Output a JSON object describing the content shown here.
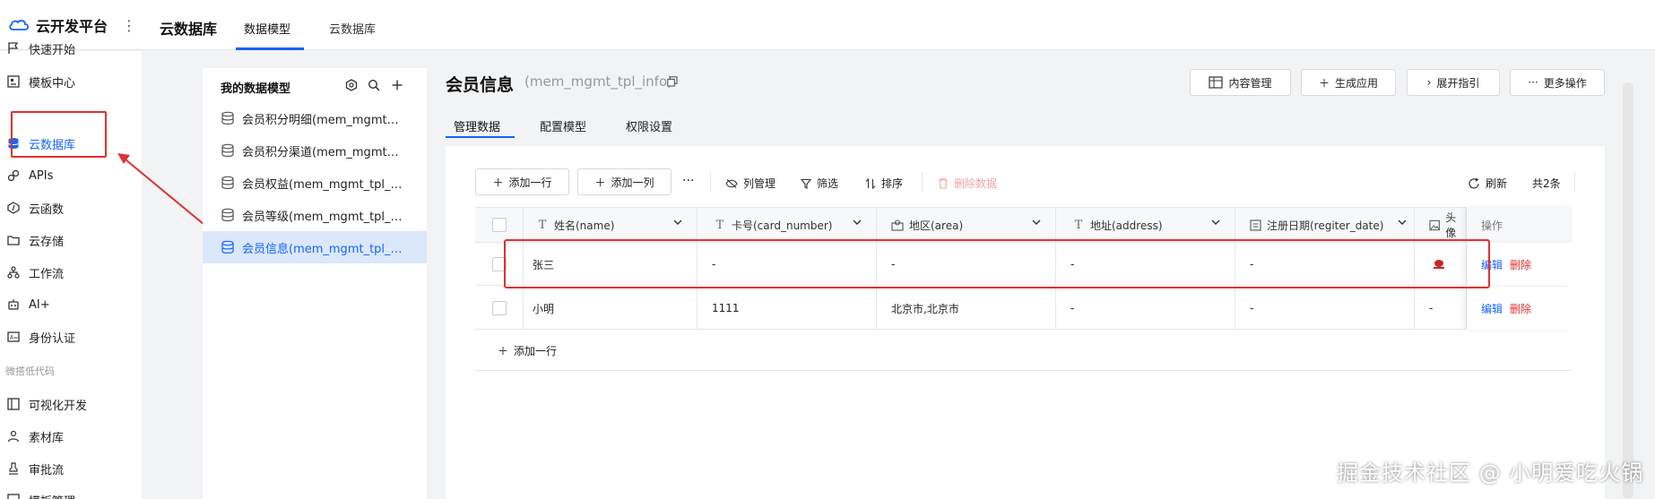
{
  "brand": {
    "title": "云开发平台",
    "more": "⋮"
  },
  "header": {
    "title": "云数据库",
    "tabs": [
      {
        "label": "数据模型",
        "active": true
      },
      {
        "label": "云数据库",
        "active": false
      }
    ]
  },
  "sidebar": {
    "items": [
      {
        "label": "快速开始",
        "icon": "flag-icon"
      },
      {
        "label": "模板中心",
        "icon": "template-icon"
      },
      {
        "label": "云数据库",
        "icon": "database-icon",
        "active": true
      },
      {
        "label": "APIs",
        "icon": "link-icon"
      },
      {
        "label": "云函数",
        "icon": "function-icon"
      },
      {
        "label": "云存储",
        "icon": "folder-icon"
      },
      {
        "label": "工作流",
        "icon": "workflow-icon"
      },
      {
        "label": "AI+",
        "icon": "robot-icon"
      },
      {
        "label": "身份认证",
        "icon": "id-card-icon"
      },
      {
        "label": "可视化开发",
        "icon": "layout-icon"
      },
      {
        "label": "素材库",
        "icon": "people-icon"
      },
      {
        "label": "审批流",
        "icon": "stamp-icon"
      },
      {
        "label": "模板管理",
        "icon": "template-manage-icon"
      }
    ],
    "section_label": "微搭低代码"
  },
  "model_panel": {
    "title": "我的数据模型",
    "items": [
      {
        "label": "会员积分明细(mem_mgmt_tpl_points_detail)"
      },
      {
        "label": "会员积分渠道(mem_mgmt_tpl_points_channel)"
      },
      {
        "label": "会员权益(mem_mgmt_tpl_rights)"
      },
      {
        "label": "会员等级(mem_mgmt_tpl_level)"
      },
      {
        "label": "会员信息(mem_mgmt_tpl_info)",
        "active": true
      }
    ]
  },
  "main": {
    "title": "会员信息",
    "subtitle": "(mem_mgmt_tpl_info)",
    "header_buttons": {
      "content_manage": "内容管理",
      "generate_app": "生成应用",
      "expand_guide": "展开指引",
      "more_ops": "更多操作"
    },
    "tabs": [
      {
        "label": "管理数据",
        "active": true
      },
      {
        "label": "配置模型",
        "active": false
      },
      {
        "label": "权限设置",
        "active": false
      }
    ]
  },
  "toolbar": {
    "add_row": "添加一行",
    "add_col": "添加一列",
    "more": "···",
    "col_manage": "列管理",
    "filter": "筛选",
    "sort": "排序",
    "delete_data": "删除数据",
    "refresh": "刷新",
    "total": "共2条"
  },
  "table": {
    "columns": {
      "name": "姓名(name)",
      "card_number": "卡号(card_number)",
      "area": "地区(area)",
      "address": "地址(address)",
      "regiter_date": "注册日期(regiter_date)",
      "avatar": "头像",
      "ops": "操作"
    },
    "rows": [
      {
        "name": "张三",
        "card_number": "-",
        "area": "-",
        "address": "-",
        "regiter_date": "-",
        "avatar": "",
        "edit": "编辑",
        "del": "删除"
      },
      {
        "name": "小明",
        "card_number": "1111",
        "area": "北京市,北京市",
        "address": "-",
        "regiter_date": "-",
        "avatar": "-",
        "edit": "编辑",
        "del": "删除"
      }
    ],
    "add_row": "添加一行"
  },
  "watermark": "掘金技术社区 @ 小明爱吃火锅",
  "colors": {
    "accent": "#1664ff",
    "danger": "#e03030",
    "active_bg": "#dbe7fb"
  }
}
